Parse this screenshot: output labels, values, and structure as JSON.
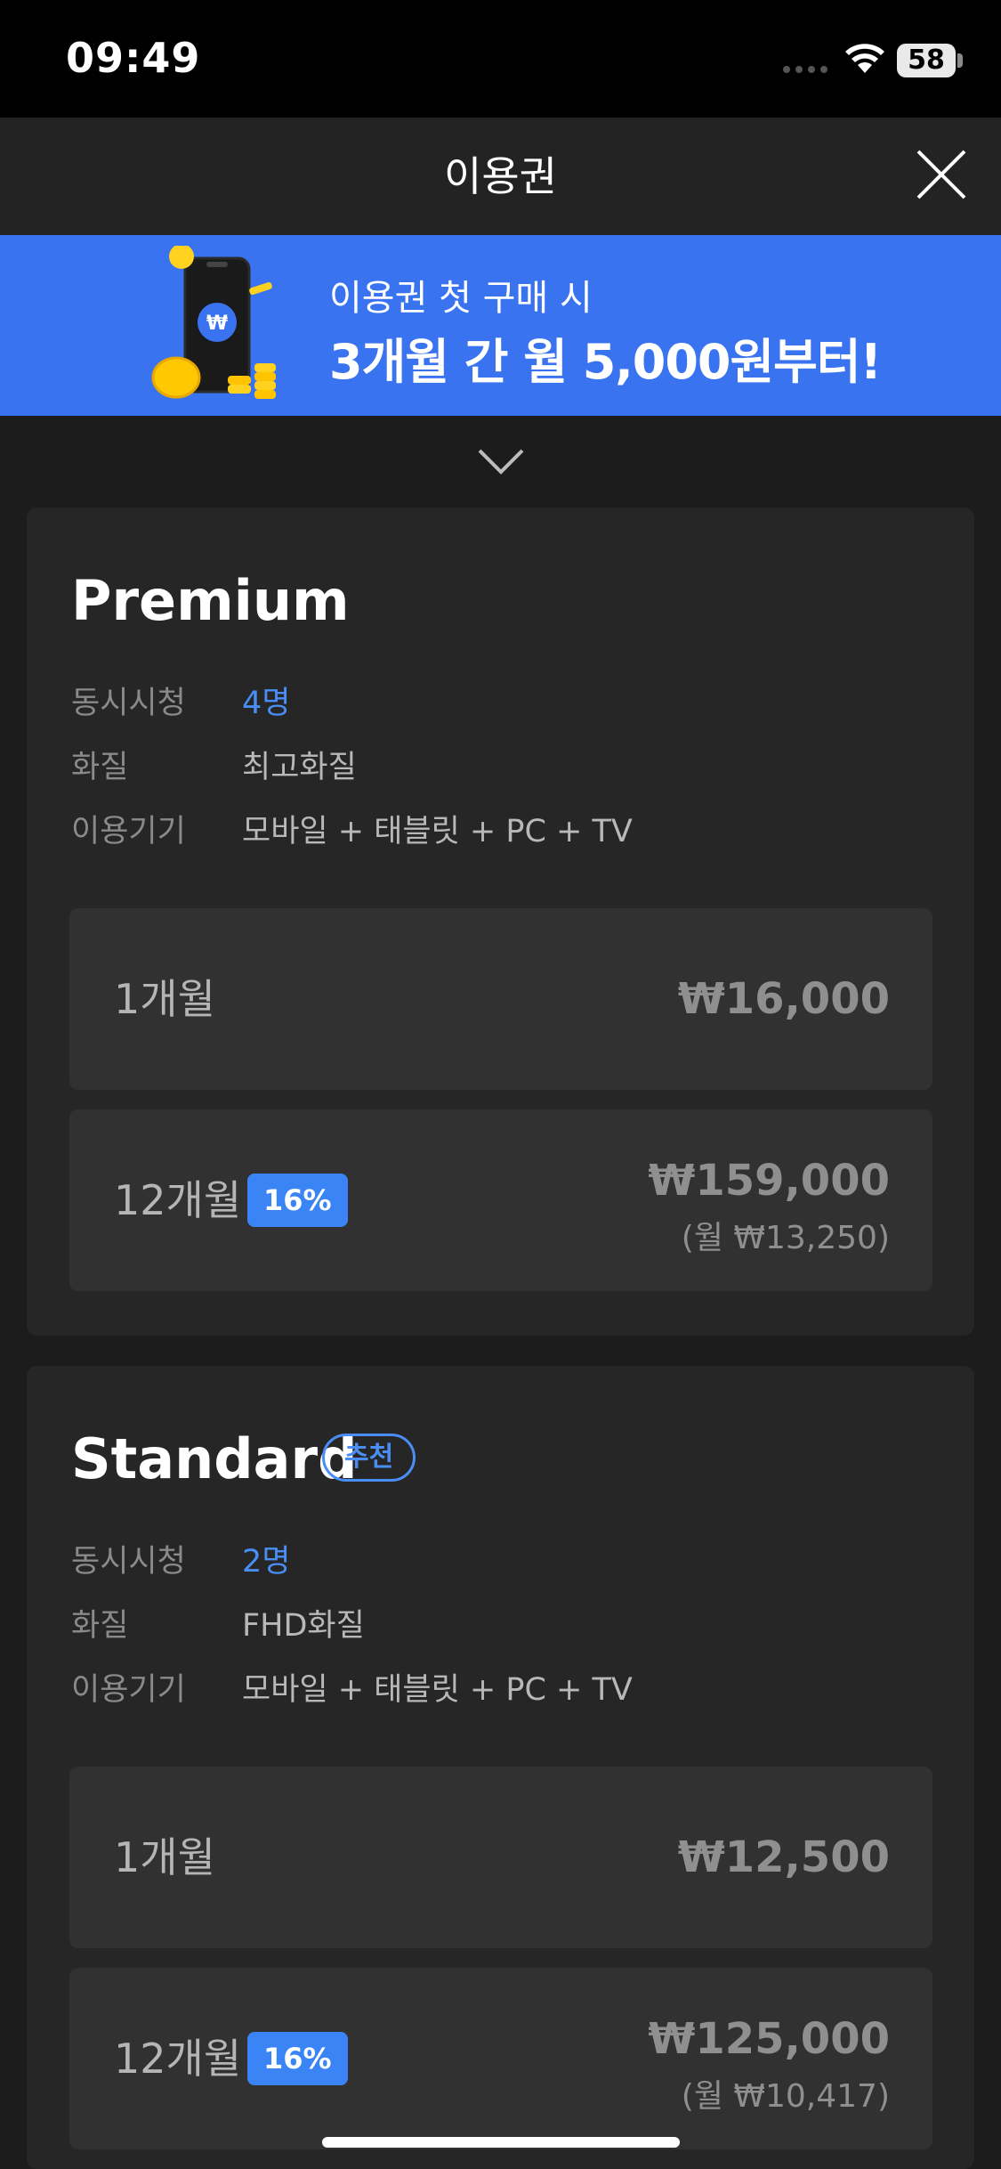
{
  "status_bar": {
    "time": "09:49",
    "battery": "58"
  },
  "header": {
    "title": "이용권"
  },
  "promo": {
    "line1": "이용권 첫 구매 시",
    "line2": "3개월 간 월 5,000원부터!",
    "coin_symbol": "₩"
  },
  "plans": [
    {
      "name": "Premium",
      "specs": [
        {
          "label": "동시시청",
          "value": "4명"
        },
        {
          "label": "화질",
          "value": "최고화질"
        },
        {
          "label": "이용기기",
          "value": "모바일 + 태블릿 + PC + TV"
        }
      ],
      "options": [
        {
          "label": "1개월",
          "price": "₩16,000"
        },
        {
          "label": "12개월",
          "badge": "16%",
          "price": "₩159,000",
          "monthly": "(월 ₩13,250)"
        }
      ]
    },
    {
      "name": "Standard",
      "recommend_badge": "추천",
      "specs": [
        {
          "label": "동시시청",
          "value": "2명"
        },
        {
          "label": "화질",
          "value": "FHD화질"
        },
        {
          "label": "이용기기",
          "value": "모바일 + 태블릿 + PC + TV"
        }
      ],
      "options": [
        {
          "label": "1개월",
          "price": "₩12,500"
        },
        {
          "label": "12개월",
          "badge": "16%",
          "price": "₩125,000",
          "monthly": "(월 ₩10,417)"
        }
      ]
    }
  ],
  "colors": {
    "accent": "#3a84f5",
    "promo_bg": "#3a73f0",
    "card_bg": "#262626",
    "option_bg": "#313131"
  },
  "icons": {
    "close": "close-icon",
    "expand": "chevron-down-icon",
    "wifi": "wifi-icon"
  }
}
